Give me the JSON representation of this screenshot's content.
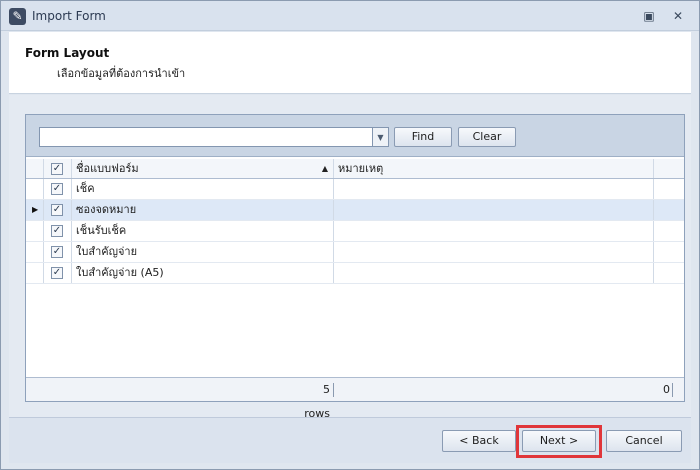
{
  "window": {
    "title": "Import Form",
    "minimize_glyph": "▣",
    "close_glyph": "✕"
  },
  "header": {
    "title": "Form Layout",
    "subtitle": "เลือกข้อมูลที่ต้องการนำเข้า"
  },
  "search": {
    "value": "",
    "placeholder": "",
    "find_label": "Find",
    "clear_label": "Clear"
  },
  "grid": {
    "columns": [
      "ชื่อแบบฟอร์ม",
      "หมายเหตุ"
    ],
    "rows": [
      {
        "name": "เช็ค",
        "note": "",
        "checked": true,
        "selected": false
      },
      {
        "name": "ซองจดหมาย",
        "note": "",
        "checked": true,
        "selected": true
      },
      {
        "name": "เช็นรับเช็ค",
        "note": "",
        "checked": true,
        "selected": false
      },
      {
        "name": "ใบสำคัญจ่าย",
        "note": "",
        "checked": true,
        "selected": false
      },
      {
        "name": "ใบสำคัญจ่าย (A5)",
        "note": "",
        "checked": true,
        "selected": false
      }
    ],
    "footer": {
      "count": "5 rows",
      "sum": "0"
    }
  },
  "buttons": {
    "back": "< Back",
    "next": "Next >",
    "cancel": "Cancel"
  },
  "colors": {
    "highlight": "#e0363a",
    "selected_row": "#dde8f7"
  }
}
